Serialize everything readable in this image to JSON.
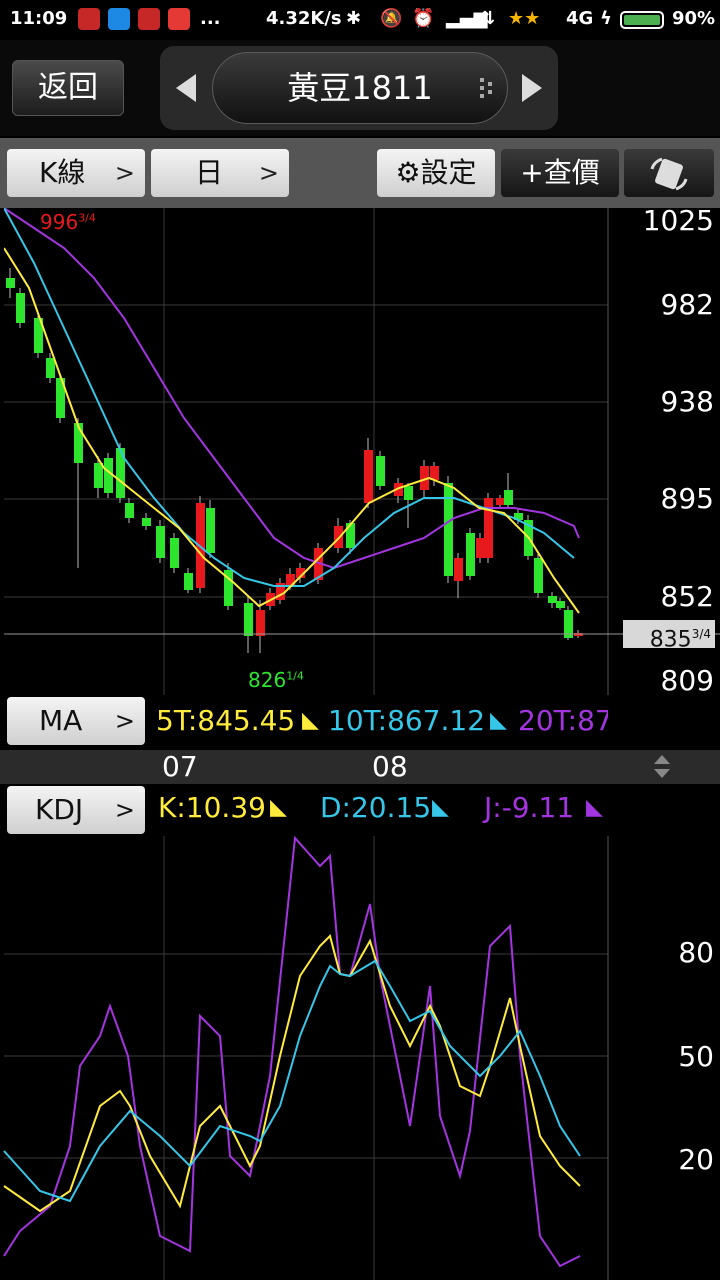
{
  "status_bar": {
    "time": "11:09",
    "more": "...",
    "net_speed": "4.32K/s",
    "network": "4G",
    "battery": "90%"
  },
  "nav": {
    "back_label": "返回",
    "title": "黃豆1811"
  },
  "toolbar": {
    "kline_label": "K線",
    "period_label": "日",
    "settings_label": "⚙設定",
    "quote_label": "+查價"
  },
  "price_axis": {
    "labels": [
      "1025",
      "982",
      "938",
      "895",
      "852",
      "809"
    ],
    "current_price": "835",
    "current_frac": "3/4",
    "high_mark": "996",
    "high_frac": "3/4",
    "low_mark": "826",
    "low_frac": "1/4"
  },
  "ma": {
    "button_label": "MA",
    "ma5": "5T:845.45",
    "ma10": "10T:867.12",
    "ma20": "20T:87"
  },
  "dates": {
    "d1": "07",
    "d2": "08"
  },
  "kdj": {
    "button_label": "KDJ",
    "k": "K:10.39",
    "d": "D:20.15",
    "j": "J:-9.11",
    "axis_labels": [
      "80",
      "50",
      "20"
    ]
  },
  "colors": {
    "up": "#e8191c",
    "down": "#2ee52e",
    "ma5": "#ffeb3b",
    "ma10": "#35c6e8",
    "ma20": "#a335e0",
    "header_bg": "#555555"
  }
}
